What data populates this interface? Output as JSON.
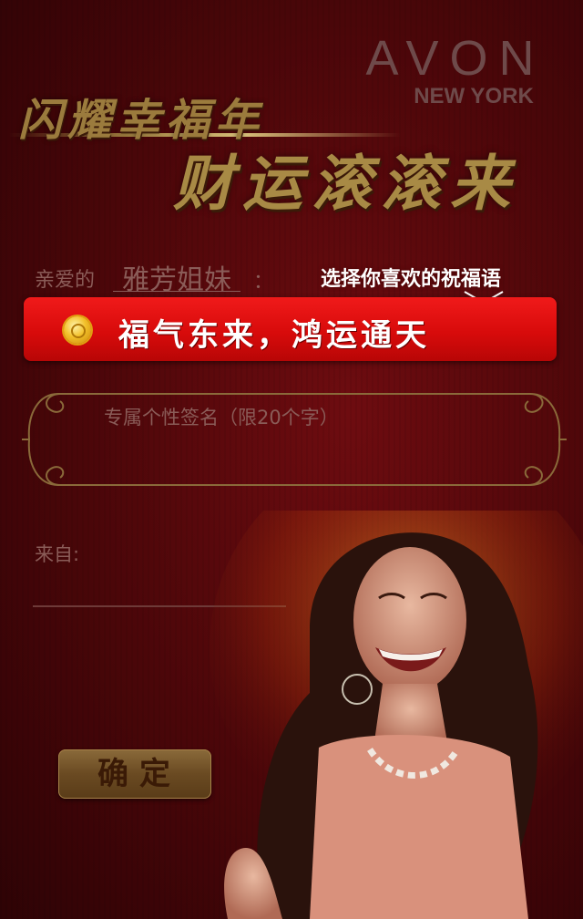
{
  "brand": {
    "name": "AVON",
    "sub": "NEW YORK"
  },
  "headline": {
    "line1": "闪耀幸福年",
    "line2": "财运滚滚来"
  },
  "greeting": {
    "label": "亲爱的",
    "name": "雅芳姐妹",
    "colon": "："
  },
  "blessing": {
    "hint": "选择你喜欢的祝福语",
    "selected": "福气东来，鸿运通天",
    "icon": "coin-icon"
  },
  "signature": {
    "placeholder": "专属个性签名（限20个字）"
  },
  "from": {
    "label": "来自:"
  },
  "confirm": {
    "label": "确定"
  },
  "colors": {
    "background": "#4a0609",
    "blessing_red": "#e01212",
    "gold": "#a88a45",
    "muted_text": "#8a5c58"
  }
}
